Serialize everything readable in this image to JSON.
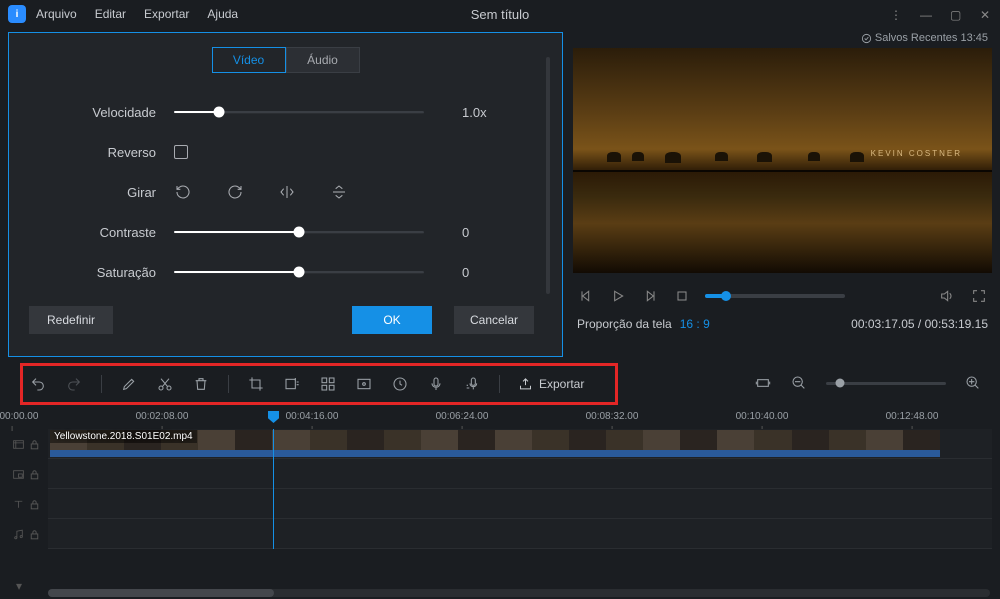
{
  "titlebar": {
    "menu": {
      "file": "Arquivo",
      "edit": "Editar",
      "export": "Exportar",
      "help": "Ajuda"
    },
    "title": "Sem título"
  },
  "props": {
    "tabs": {
      "video": "Vídeo",
      "audio": "Áudio"
    },
    "labels": {
      "speed": "Velocidade",
      "reverse": "Reverso",
      "rotate": "Girar",
      "contrast": "Contraste",
      "saturation": "Saturação"
    },
    "values": {
      "speed": "1.0x",
      "contrast": "0",
      "saturation": "0"
    },
    "buttons": {
      "reset": "Redefinir",
      "ok": "OK",
      "cancel": "Cancelar"
    }
  },
  "preview": {
    "save_status": "Salvos Recentes 13:45",
    "credit": "KEVIN COSTNER",
    "ratio_label": "Proporção da tela",
    "ratio_value": "16 : 9",
    "time_current": "00:03:17.05",
    "time_total": "00:53:19.15"
  },
  "toolbar": {
    "export": "Exportar"
  },
  "timeline": {
    "ticks": [
      "00:00:00.00",
      "00:02:08.00",
      "00:04:16.00",
      "00:06:24.00",
      "00:08:32.00",
      "00:10:40.00",
      "00:12:48.00"
    ],
    "clip_name": "Yellowstone.2018.S01E02.mp4"
  }
}
